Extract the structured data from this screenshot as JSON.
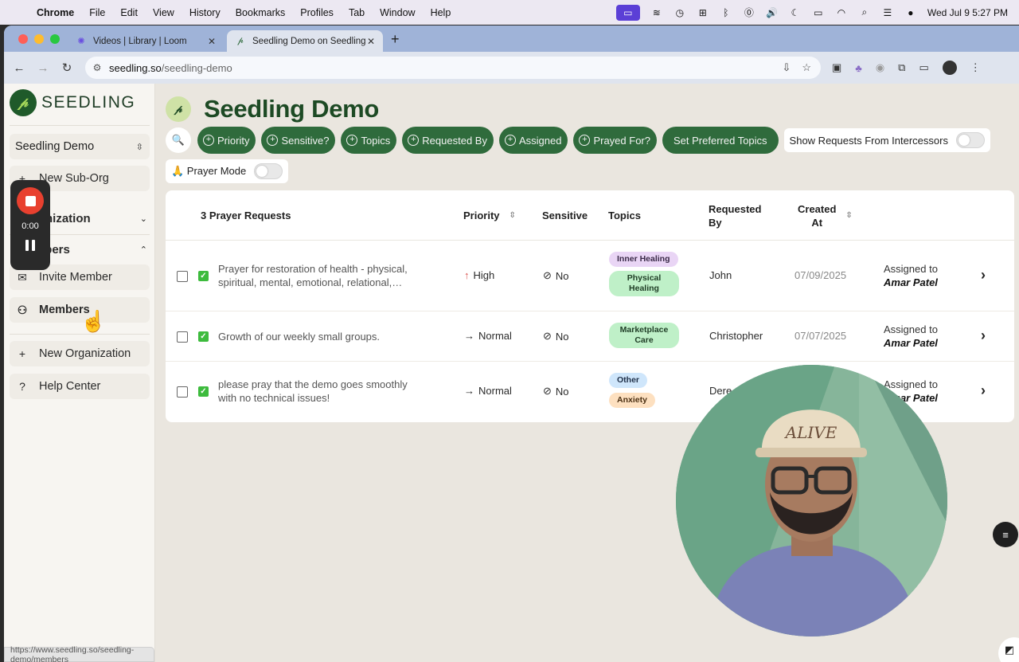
{
  "menubar": {
    "app": "Chrome",
    "items": [
      "File",
      "Edit",
      "View",
      "History",
      "Bookmarks",
      "Profiles",
      "Tab",
      "Window",
      "Help"
    ],
    "clock": "Wed Jul 9  5:27 PM"
  },
  "browser": {
    "tabs": [
      {
        "title": "Videos | Library | Loom",
        "icon": "loom-icon"
      },
      {
        "title": "Seedling Demo on Seedling",
        "icon": "seedling-icon"
      }
    ],
    "url_host": "seedling.so",
    "url_path": "/seedling-demo",
    "status_url": "https://www.seedling.so/seedling-demo/members"
  },
  "sidebar": {
    "logo_text": "SEEDLING",
    "org_select": "Seedling Demo",
    "new_sub_org": "New Sub-Org",
    "organization_section": "Organization",
    "members_section": "Members",
    "invite_member": "Invite Member",
    "members": "Members",
    "new_organization": "New Organization",
    "help_center": "Help Center"
  },
  "recorder": {
    "time": "0:00"
  },
  "main": {
    "title": "Seedling Demo",
    "filters": {
      "priority": "Priority",
      "sensitive": "Sensitive?",
      "topics": "Topics",
      "requested_by": "Requested By",
      "assigned": "Assigned",
      "prayed_for": "Prayed For?",
      "preferred_topics": "Set Preferred Topics",
      "show_intercessors": "Show Requests From Intercessors",
      "prayer_mode": "🙏 Prayer Mode"
    },
    "table": {
      "headers": {
        "count": "3 Prayer Requests",
        "priority": "Priority",
        "sensitive": "Sensitive",
        "topics": "Topics",
        "requested_by_1": "Requested",
        "requested_by_2": "By",
        "created_at_1": "Created",
        "created_at_2": "At"
      },
      "rows": [
        {
          "request_1": "Prayer for restoration of health - physical,",
          "request_2": "spiritual, mental, emotional, relational,…",
          "priority": "High",
          "priority_icon": "↑",
          "sensitive": "No",
          "topic_1": "Inner Healing",
          "topic_2": "Physical Healing",
          "requested_by": "John",
          "created": "07/09/2025",
          "assigned_label": "Assigned to",
          "assigned_to": "Amar Patel"
        },
        {
          "request_1": "Growth of our weekly small groups.",
          "request_2": "",
          "priority": "Normal",
          "priority_icon": "→",
          "sensitive": "No",
          "topic_1": "Marketplace Care",
          "topic_2": "",
          "requested_by": "Christopher",
          "created": "07/07/2025",
          "assigned_label": "Assigned to",
          "assigned_to": "Amar Patel"
        },
        {
          "request_1": "please pray that the demo goes smoothly",
          "request_2": "with no technical issues!",
          "priority": "Normal",
          "priority_icon": "→",
          "sensitive": "No",
          "topic_1": "Other",
          "topic_2": "Anxiety",
          "requested_by": "Dere",
          "created": "",
          "assigned_label": "Assigned to",
          "assigned_to": "Amar Patel"
        }
      ]
    }
  },
  "colors": {
    "brand_green": "#2f6b3c",
    "title_green": "#1d4a24",
    "page_bg": "#eae6df",
    "record_red": "#e8402f",
    "tag_purple": "#e9d5f5",
    "tag_green": "#bff0c8",
    "tag_blue": "#cfe6fb",
    "tag_orange": "#fde0c0"
  }
}
